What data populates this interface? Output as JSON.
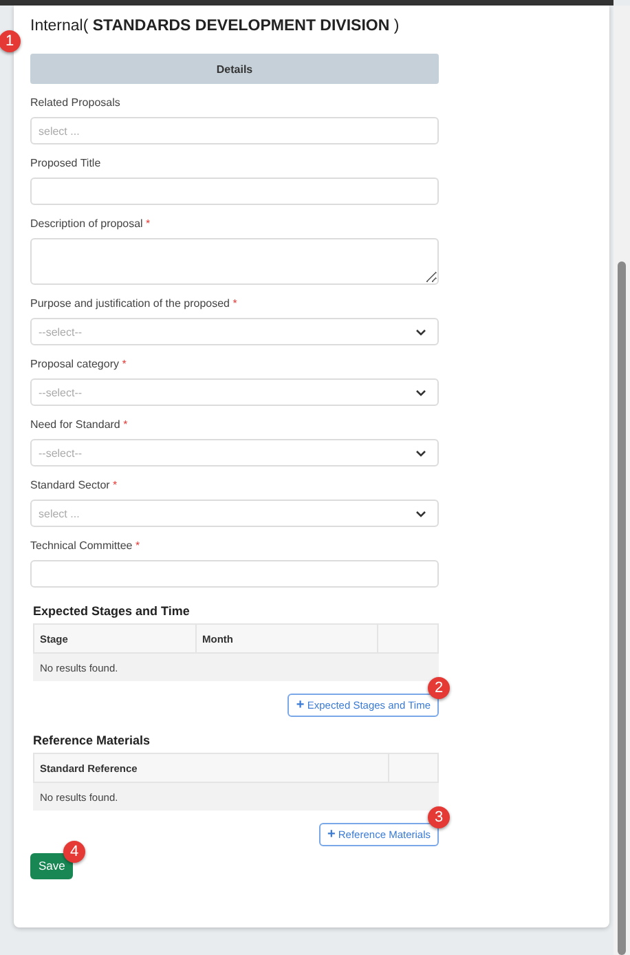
{
  "title": {
    "prefix": "Internal(",
    "bold": "STANDARDS DEVELOPMENT DIVISION",
    "suffix": ")"
  },
  "details": {
    "label": "Details",
    "marker": "1"
  },
  "fields": [
    {
      "kind": "select-search",
      "label": "Related Proposals",
      "placeholder": "select ..."
    },
    {
      "kind": "text",
      "label": "Proposed Title"
    },
    {
      "kind": "textarea",
      "label": "Description of proposal",
      "required_mark": "*"
    },
    {
      "kind": "select",
      "label": "Purpose and justification of the proposed",
      "required_mark": "*",
      "placeholder": "--select--"
    },
    {
      "kind": "select",
      "label": "Proposal category",
      "required_mark": "*",
      "placeholder": "--select--"
    },
    {
      "kind": "select",
      "label": "Need for Standard",
      "required_mark": "*",
      "placeholder": "--select--"
    },
    {
      "kind": "select",
      "label": "Standard Sector",
      "required_mark": "*",
      "placeholder": "select ..."
    },
    {
      "kind": "text",
      "label": "Technical Committee",
      "required_mark": "*"
    }
  ],
  "sections": [
    {
      "title": "Expected Stages and Time",
      "columns": [
        "Stage",
        "Month",
        ""
      ],
      "empty": "No results found.",
      "button": {
        "icon": "+",
        "label": "Expected Stages and Time",
        "marker": "2"
      }
    },
    {
      "title": "Reference Materials",
      "columns": [
        "Standard Reference",
        ""
      ],
      "empty": "No results found.",
      "button": {
        "icon": "+",
        "label": "Reference Materials",
        "marker": "3"
      }
    }
  ],
  "save": {
    "label": "Save",
    "marker": "4"
  }
}
